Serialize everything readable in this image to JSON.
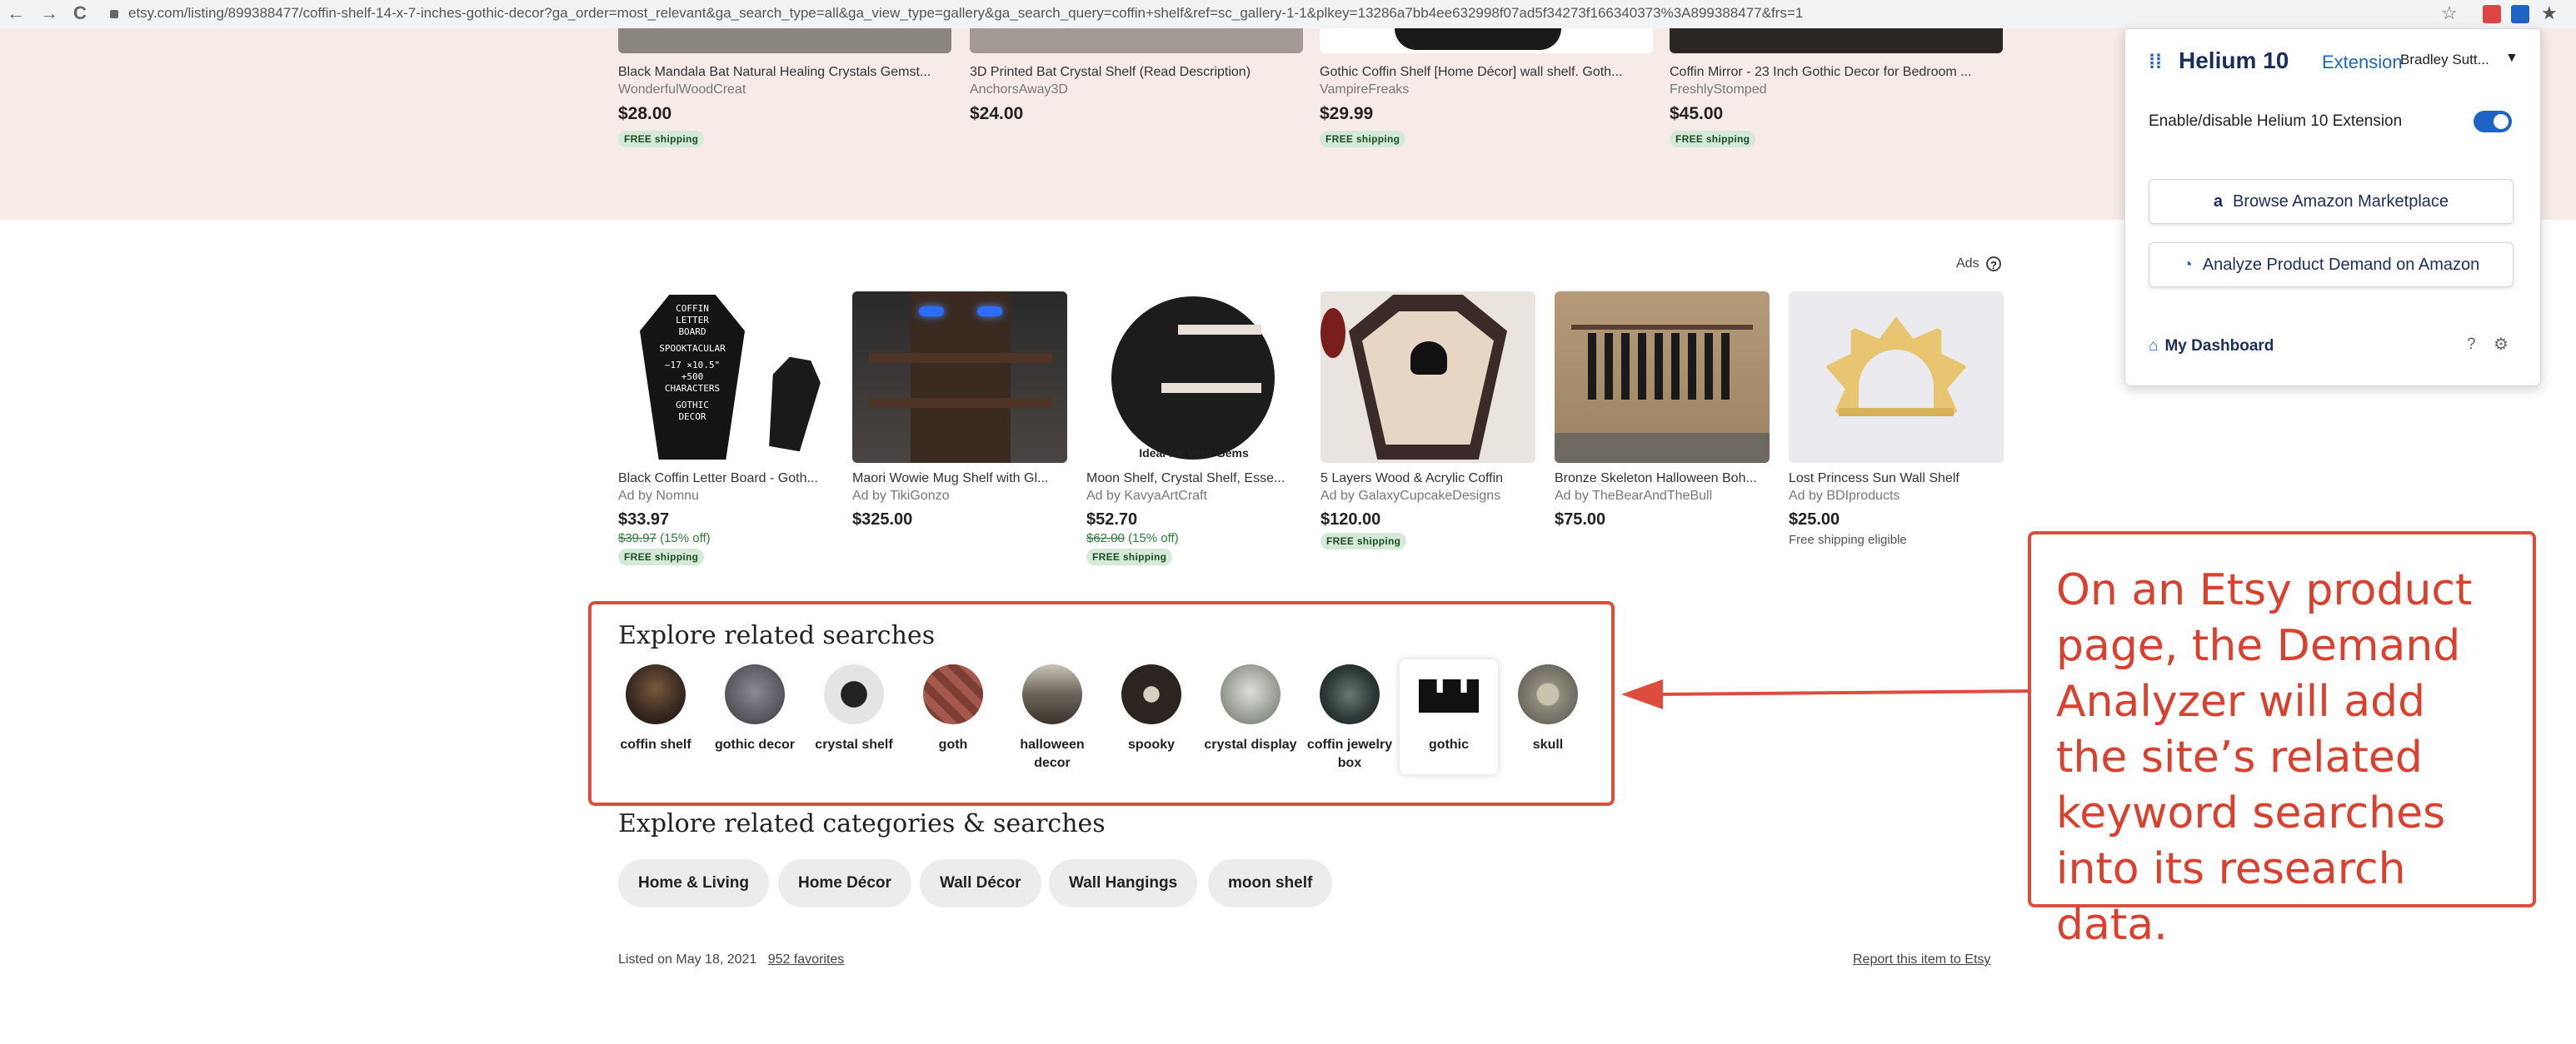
{
  "browser": {
    "url": "etsy.com/listing/899388477/coffin-shelf-14-x-7-inches-gothic-decor?ga_order=most_relevant&ga_search_type=all&ga_view_type=gallery&ga_search_query=coffin+shelf&ref=sc_gallery-1-1&plkey=13286a7bb4ee632998f07ad5f34273f166340373%3A899388477&frs=1",
    "back_icon": "←",
    "forward_icon": "→",
    "reload_icon": "C",
    "star_icon": "☆",
    "menu_icon": "★"
  },
  "top_row": [
    {
      "title": "Black Mandala Bat Natural Healing Crystals Gemst...",
      "shop": "WonderfulWoodCreat",
      "price": "$28.00",
      "shipping": "FREE shipping"
    },
    {
      "title": "3D Printed Bat Crystal Shelf (Read Description)",
      "shop": "AnchorsAway3D",
      "price": "$24.00",
      "shipping": ""
    },
    {
      "title": "Gothic Coffin Shelf [Home Décor] wall shelf. Goth...",
      "shop": "VampireFreaks",
      "price": "$29.99",
      "shipping": "FREE shipping"
    },
    {
      "title": "Coffin Mirror - 23 Inch Gothic Decor for Bedroom ...",
      "shop": "FreshlyStomped",
      "price": "$45.00",
      "shipping": "FREE shipping"
    }
  ],
  "ads": {
    "label": "Ads",
    "help": "?",
    "items": [
      {
        "title": "Black Coffin Letter Board - Goth...",
        "shop": "Ad by Nomnu",
        "price": "$33.97",
        "original": "$39.97",
        "discount": "(15% off)",
        "shipping": "FREE shipping",
        "note": "",
        "image_text": [
          "COFFIN",
          "LETTER",
          "BOARD",
          "SPOOKTACULAR",
          "~17 ×10.5\"",
          "+500",
          "CHARACTERS",
          "GOTHIC",
          "DECOR"
        ]
      },
      {
        "title": "Maori Wowie Mug Shelf with Gl...",
        "shop": "Ad by TikiGonzo",
        "price": "$325.00",
        "original": "",
        "discount": "",
        "shipping": "",
        "note": ""
      },
      {
        "title": "Moon Shelf, Crystal Shelf, Esse...",
        "shop": "Ad by KavyaArtCraft",
        "price": "$52.70",
        "original": "$62.00",
        "discount": "(15% off)",
        "shipping": "FREE shipping",
        "note": "",
        "image_text": "Ideal for your Gems"
      },
      {
        "title": "5 Layers Wood & Acrylic Coffin",
        "shop": "Ad by GalaxyCupcakeDesigns",
        "price": "$120.00",
        "original": "",
        "discount": "",
        "shipping": "FREE shipping",
        "note": ""
      },
      {
        "title": "Bronze Skeleton Halloween Boh...",
        "shop": "Ad by TheBearAndTheBull",
        "price": "$75.00",
        "original": "",
        "discount": "",
        "shipping": "",
        "note": ""
      },
      {
        "title": "Lost Princess Sun Wall Shelf",
        "shop": "Ad by BDIproducts",
        "price": "$25.00",
        "original": "",
        "discount": "",
        "shipping": "",
        "note": "Free shipping eligible"
      }
    ]
  },
  "related_searches": {
    "title": "Explore related searches",
    "items": [
      {
        "label": "coffin shelf",
        "color": "#3a2a22"
      },
      {
        "label": "gothic decor",
        "color": "#5a5a62"
      },
      {
        "label": "crystal shelf",
        "color": "#e6e3e6"
      },
      {
        "label": "goth",
        "color": "#a35a4c"
      },
      {
        "label": "halloween decor",
        "color": "#6b6358"
      },
      {
        "label": "spooky",
        "color": "#2b2420"
      },
      {
        "label": "crystal display",
        "color": "#9ea39a"
      },
      {
        "label": "coffin jewelry box",
        "color": "#2f3a3a"
      },
      {
        "label": "gothic",
        "color": "#111111"
      },
      {
        "label": "skull",
        "color": "#8f8b7d"
      }
    ]
  },
  "categories": {
    "title": "Explore related categories & searches",
    "pills": [
      "Home & Living",
      "Home Décor",
      "Wall Décor",
      "Wall Hangings",
      "moon shelf"
    ]
  },
  "footer": {
    "listed": "Listed on May 18, 2021",
    "favorites": "952 favorites",
    "report": "Report this item to Etsy"
  },
  "callout": {
    "text": "On an Etsy product page, the Demand Analyzer will add the site’s related keyword searches into its research data."
  },
  "helium10": {
    "brand": "Helium 10",
    "extension": "Extension",
    "user": "Bradley Sutt...",
    "toggle_label": "Enable/disable Helium 10 Extension",
    "toggle_on": true,
    "browse_button": "Browse Amazon Marketplace",
    "analyze_button": "Analyze Product Demand on Amazon",
    "dashboard": "My Dashboard"
  },
  "colors": {
    "accent_red": "#dc4d3e",
    "helium_blue": "#1e63c6",
    "etsy_pink_band": "#f6ebe7",
    "free_ship_bg": "#d4e9d7"
  }
}
